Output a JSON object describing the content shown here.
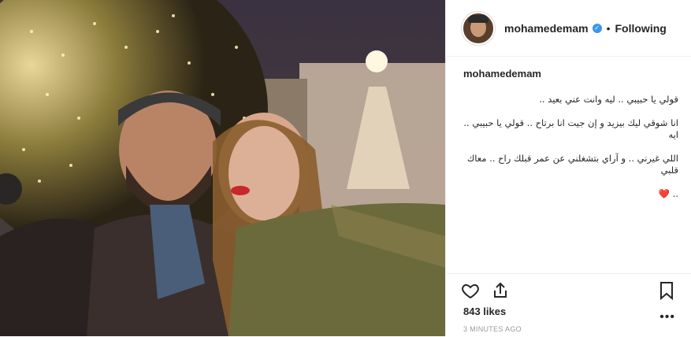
{
  "post": {
    "username": "mohamedemam",
    "follow_status": "Following",
    "separator": "•",
    "caption": {
      "username": "mohamedemam",
      "lines": [
        "قولي يا حبيبي .. ليه وانت عني بعيد ..",
        "انا شوقي ليك بيزيد و إن جيت انا برتاح .. قولي يا حبيبي .. ايه",
        "اللي غيرني .. و آراي بتشغلني عن عمر قبلك راح .. معاك قلبي",
        ".. ❤️"
      ]
    },
    "likes": "843 likes",
    "timestamp": "3 MINUTES AGO",
    "more_label": "•••"
  },
  "icons": {
    "verified": "verified-badge-icon",
    "like": "heart-icon",
    "share": "share-icon",
    "save": "bookmark-icon"
  },
  "colors": {
    "verified": "#3897f0",
    "text": "#262626",
    "muted": "#999999"
  }
}
